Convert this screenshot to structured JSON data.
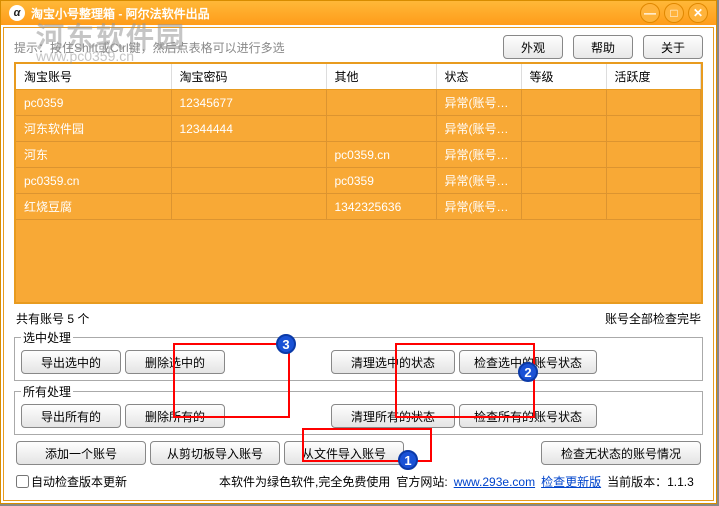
{
  "titlebar": {
    "title": "淘宝小号整理箱 - 阿尔法软件出品"
  },
  "hint": "提示：按住Shift或Ctrl键，然后点表格可以进行多选",
  "topbuttons": {
    "appearance": "外观",
    "help": "帮助",
    "about": "关于"
  },
  "columns": [
    "淘宝账号",
    "淘宝密码",
    "其他",
    "状态",
    "等级",
    "活跃度"
  ],
  "rows": [
    {
      "acc": "pc0359",
      "pwd": "12345677",
      "other": "",
      "status": "异常(账号…"
    },
    {
      "acc": "河东软件园",
      "pwd": "12344444",
      "other": "",
      "status": "异常(账号…"
    },
    {
      "acc": "河东",
      "pwd": "",
      "other": "pc0359.cn",
      "status": "异常(账号…"
    },
    {
      "acc": "pc0359.cn",
      "pwd": "",
      "other": "pc0359",
      "status": "异常(账号…"
    },
    {
      "acc": "红烧豆腐",
      "pwd": "",
      "other": "1342325636",
      "status": "异常(账号…"
    }
  ],
  "count_text": "共有账号 5 个",
  "status_text": "账号全部检查完毕",
  "group_selected": {
    "legend": "选中处理",
    "export": "导出选中的",
    "delete": "删除选中的",
    "clear": "清理选中的状态",
    "check": "检查选中的账号状态"
  },
  "group_all": {
    "legend": "所有处理",
    "export": "导出所有的",
    "delete": "删除所有的",
    "clear": "清理所有的状态",
    "check": "检查所有的账号状态"
  },
  "bottom_buttons": {
    "add": "添加一个账号",
    "clip": "从剪切板导入账号",
    "file": "从文件导入账号",
    "check_nostatus": "检查无状态的账号情况"
  },
  "footer": {
    "autocheck": "自动检查版本更新",
    "greentext": "本软件为绿色软件,完全免费使用",
    "site_label": "官方网站:",
    "site_link": "www.293e.com",
    "update_link": "检查更新版",
    "version_label": "当前版本：1.1.3"
  },
  "watermark": {
    "line1": "河东软件园",
    "line2": "www.pc0359.cn"
  }
}
